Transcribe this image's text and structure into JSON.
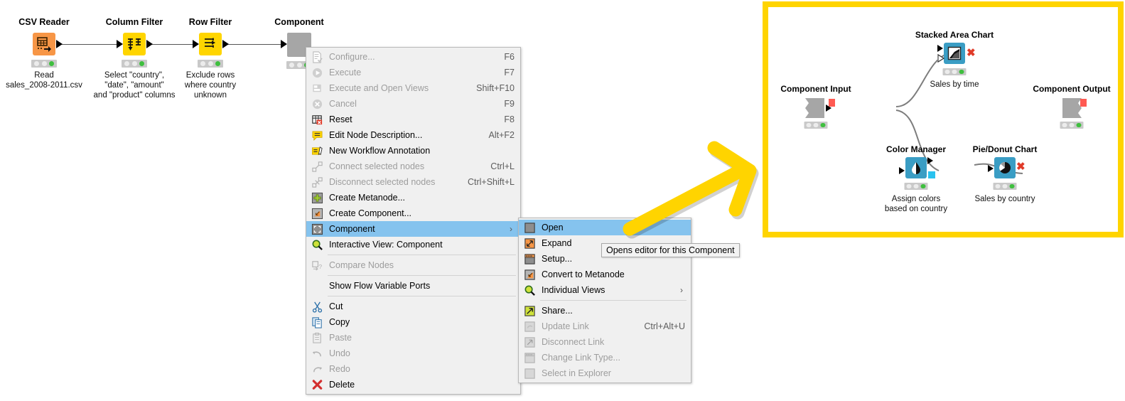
{
  "workflow": {
    "nodes": [
      {
        "title": "CSV Reader",
        "desc": "Read\nsales_2008-2011.csv",
        "icon": "csv-reader-icon",
        "color": "#f79646",
        "status": "executed"
      },
      {
        "title": "Column Filter",
        "desc": "Select \"country\",\n\"date\", \"amount\"\nand \"product\" columns",
        "icon": "column-filter-icon",
        "color": "#ffd500",
        "status": "executed"
      },
      {
        "title": "Row Filter",
        "desc": "Exclude rows\nwhere country\nunknown",
        "icon": "row-filter-icon",
        "color": "#ffd500",
        "status": "executed"
      },
      {
        "title": "Component",
        "desc": "",
        "icon": "component-icon",
        "color": "#a6a6a6",
        "status": "executed"
      }
    ]
  },
  "context_menu": {
    "items": [
      {
        "label": "Configure...",
        "shortcut": "F6",
        "icon": "configure-icon",
        "disabled": true,
        "separator_after": false
      },
      {
        "label": "Execute",
        "shortcut": "F7",
        "icon": "execute-icon",
        "disabled": true,
        "separator_after": false
      },
      {
        "label": "Execute and Open Views",
        "shortcut": "Shift+F10",
        "icon": "execute-open-views-icon",
        "disabled": true,
        "separator_after": false
      },
      {
        "label": "Cancel",
        "shortcut": "F9",
        "icon": "cancel-icon",
        "disabled": true,
        "separator_after": false
      },
      {
        "label": "Reset",
        "shortcut": "F8",
        "icon": "reset-icon",
        "disabled": false,
        "separator_after": false
      },
      {
        "label": "Edit Node Description...",
        "shortcut": "Alt+F2",
        "icon": "edit-description-icon",
        "disabled": false,
        "separator_after": false
      },
      {
        "label": "New Workflow Annotation",
        "shortcut": "",
        "icon": "annotation-icon",
        "disabled": false,
        "separator_after": false
      },
      {
        "label": "Connect selected nodes",
        "shortcut": "Ctrl+L",
        "icon": "connect-nodes-icon",
        "disabled": true,
        "separator_after": false
      },
      {
        "label": "Disconnect selected nodes",
        "shortcut": "Ctrl+Shift+L",
        "icon": "disconnect-nodes-icon",
        "disabled": true,
        "separator_after": false
      },
      {
        "label": "Create Metanode...",
        "shortcut": "",
        "icon": "create-metanode-icon",
        "disabled": false,
        "separator_after": false
      },
      {
        "label": "Create Component...",
        "shortcut": "",
        "icon": "create-component-icon",
        "disabled": false,
        "separator_after": false
      },
      {
        "label": "Component",
        "shortcut": "",
        "icon": "component-menu-icon",
        "disabled": false,
        "selected": true,
        "submenu": true,
        "separator_after": false
      },
      {
        "label": "Interactive View: Component",
        "shortcut": "",
        "icon": "interactive-view-icon",
        "disabled": false,
        "separator_after": true
      },
      {
        "label": "Compare Nodes",
        "shortcut": "",
        "icon": "compare-nodes-icon",
        "disabled": true,
        "separator_after": true
      },
      {
        "label": "Show Flow Variable Ports",
        "shortcut": "",
        "icon": "",
        "disabled": false,
        "separator_after": true
      },
      {
        "label": "Cut",
        "shortcut": "",
        "icon": "cut-icon",
        "disabled": false,
        "separator_after": false
      },
      {
        "label": "Copy",
        "shortcut": "",
        "icon": "copy-icon",
        "disabled": false,
        "separator_after": false
      },
      {
        "label": "Paste",
        "shortcut": "",
        "icon": "paste-icon",
        "disabled": true,
        "separator_after": false
      },
      {
        "label": "Undo",
        "shortcut": "",
        "icon": "undo-icon",
        "disabled": true,
        "separator_after": false
      },
      {
        "label": "Redo",
        "shortcut": "",
        "icon": "redo-icon",
        "disabled": true,
        "separator_after": false
      },
      {
        "label": "Delete",
        "shortcut": "",
        "icon": "delete-icon",
        "disabled": false,
        "separator_after": false
      }
    ]
  },
  "submenu": {
    "items": [
      {
        "label": "Open",
        "shortcut": "",
        "icon": "open-icon",
        "disabled": false,
        "selected": true,
        "separator_after": false
      },
      {
        "label": "Expand",
        "shortcut": "",
        "icon": "expand-icon",
        "disabled": false,
        "separator_after": false
      },
      {
        "label": "Setup...",
        "shortcut": "",
        "icon": "setup-icon",
        "disabled": false,
        "separator_after": false
      },
      {
        "label": "Convert to Metanode",
        "shortcut": "",
        "icon": "convert-metanode-icon",
        "disabled": false,
        "separator_after": false
      },
      {
        "label": "Individual Views",
        "shortcut": "",
        "icon": "individual-views-icon",
        "disabled": false,
        "submenu": true,
        "separator_after": true
      },
      {
        "label": "Share...",
        "shortcut": "",
        "icon": "share-icon",
        "disabled": false,
        "separator_after": false
      },
      {
        "label": "Update Link",
        "shortcut": "Ctrl+Alt+U",
        "icon": "update-link-icon",
        "disabled": true,
        "separator_after": false
      },
      {
        "label": "Disconnect Link",
        "shortcut": "",
        "icon": "disconnect-link-icon",
        "disabled": true,
        "separator_after": false
      },
      {
        "label": "Change Link Type...",
        "shortcut": "",
        "icon": "change-link-type-icon",
        "disabled": true,
        "separator_after": false
      },
      {
        "label": "Select in Explorer",
        "shortcut": "",
        "icon": "select-explorer-icon",
        "disabled": true,
        "separator_after": false
      }
    ]
  },
  "tooltip": {
    "text": "Opens editor for this Component"
  },
  "panel": {
    "border_color": "#ffd400",
    "nodes": [
      {
        "title": "Component Input",
        "desc": "",
        "icon": "component-input-icon",
        "status": "executed"
      },
      {
        "title": "Stacked Area Chart",
        "desc": "Sales by time",
        "icon": "stacked-area-chart-icon",
        "status": "executed"
      },
      {
        "title": "Color Manager",
        "desc": "Assign colors\nbased on country",
        "icon": "color-manager-icon",
        "status": "executed"
      },
      {
        "title": "Pie/Donut Chart",
        "desc": "Sales by country",
        "icon": "pie-donut-chart-icon",
        "status": "executed"
      },
      {
        "title": "Component Output",
        "desc": "",
        "icon": "component-output-icon",
        "status": "executed"
      }
    ]
  },
  "annotation": {
    "arrow_color": "#ffd400",
    "arrow_name": "pointer-arrow"
  }
}
